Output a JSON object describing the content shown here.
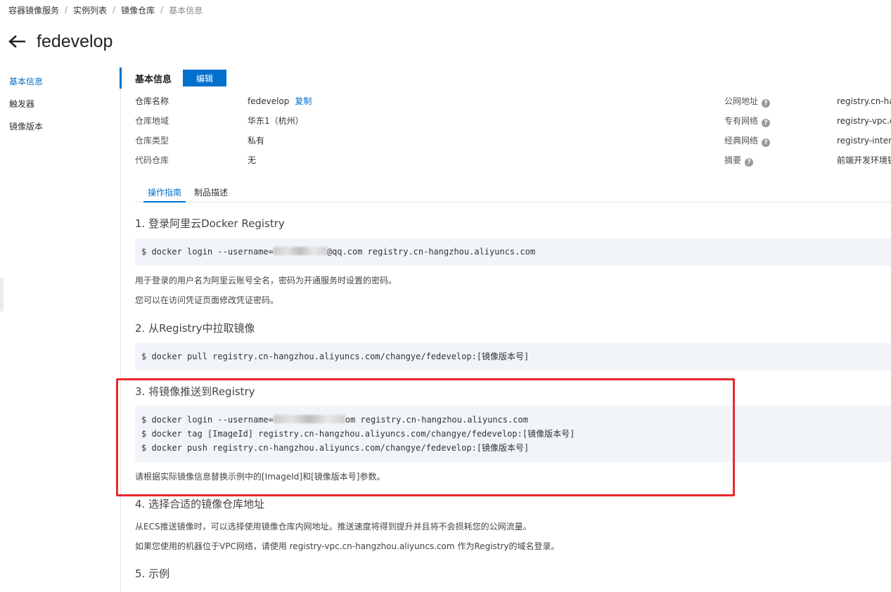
{
  "breadcrumb": {
    "items": [
      "容器镜像服务",
      "实例列表",
      "镜像仓库",
      "基本信息"
    ],
    "separator": "/"
  },
  "page": {
    "title": "fedevelop"
  },
  "sidebar": {
    "items": [
      {
        "label": "基本信息",
        "active": true
      },
      {
        "label": "触发器",
        "active": false
      },
      {
        "label": "镜像版本",
        "active": false
      }
    ]
  },
  "basic_info": {
    "title": "基本信息",
    "edit_label": "编辑",
    "left": [
      {
        "label": "仓库名称",
        "value": "fedevelop",
        "action": "复制"
      },
      {
        "label": "仓库地域",
        "value": "华东1（杭州）"
      },
      {
        "label": "仓库类型",
        "value": "私有"
      },
      {
        "label": "代码仓库",
        "value": "无"
      }
    ],
    "right": [
      {
        "label": "公网地址",
        "value": "registry.cn-han"
      },
      {
        "label": "专有网络",
        "value": "registry-vpc.cn"
      },
      {
        "label": "经典网络",
        "value": "registry-interna"
      },
      {
        "label": "摘要",
        "value": "前端开发环境镜"
      }
    ],
    "help_glyph": "?"
  },
  "tabs": [
    {
      "label": "操作指南",
      "active": true
    },
    {
      "label": "制品描述",
      "active": false
    }
  ],
  "guide": {
    "step1": {
      "title": "1. 登录阿里云Docker Registry",
      "cmd_prefix": "$ docker login --username=",
      "cmd_suffix": "@qq.com registry.cn-hangzhou.aliyuncs.com",
      "note1": "用于登录的用户名为阿里云账号全名，密码为开通服务时设置的密码。",
      "note2": "您可以在访问凭证页面修改凭证密码。"
    },
    "step2": {
      "title": "2. 从Registry中拉取镜像",
      "cmd": "$ docker pull registry.cn-hangzhou.aliyuncs.com/changye/fedevelop:[镜像版本号]"
    },
    "step3": {
      "title": "3. 将镜像推送到Registry",
      "cmd1_prefix": "$ docker login --username=",
      "cmd1_suffix": "om registry.cn-hangzhou.aliyuncs.com",
      "cmd2": "$ docker tag [ImageId] registry.cn-hangzhou.aliyuncs.com/changye/fedevelop:[镜像版本号]",
      "cmd3": "$ docker push registry.cn-hangzhou.aliyuncs.com/changye/fedevelop:[镜像版本号]",
      "note": "请根据实际镜像信息替换示例中的[ImageId]和[镜像版本号]参数。"
    },
    "step4": {
      "title": "4. 选择合适的镜像仓库地址",
      "note1": "从ECS推送镜像时，可以选择使用镜像仓库内网地址。推送速度将得到提升并且将不会损耗您的公网流量。",
      "note2": "如果您使用的机器位于VPC网络，请使用 registry-vpc.cn-hangzhou.aliyuncs.com 作为Registry的域名登录。"
    },
    "step5": {
      "title": "5. 示例"
    }
  },
  "colors": {
    "accent": "#0070cc",
    "highlight": "#e8282e",
    "code_bg": "#f1f5fa"
  }
}
